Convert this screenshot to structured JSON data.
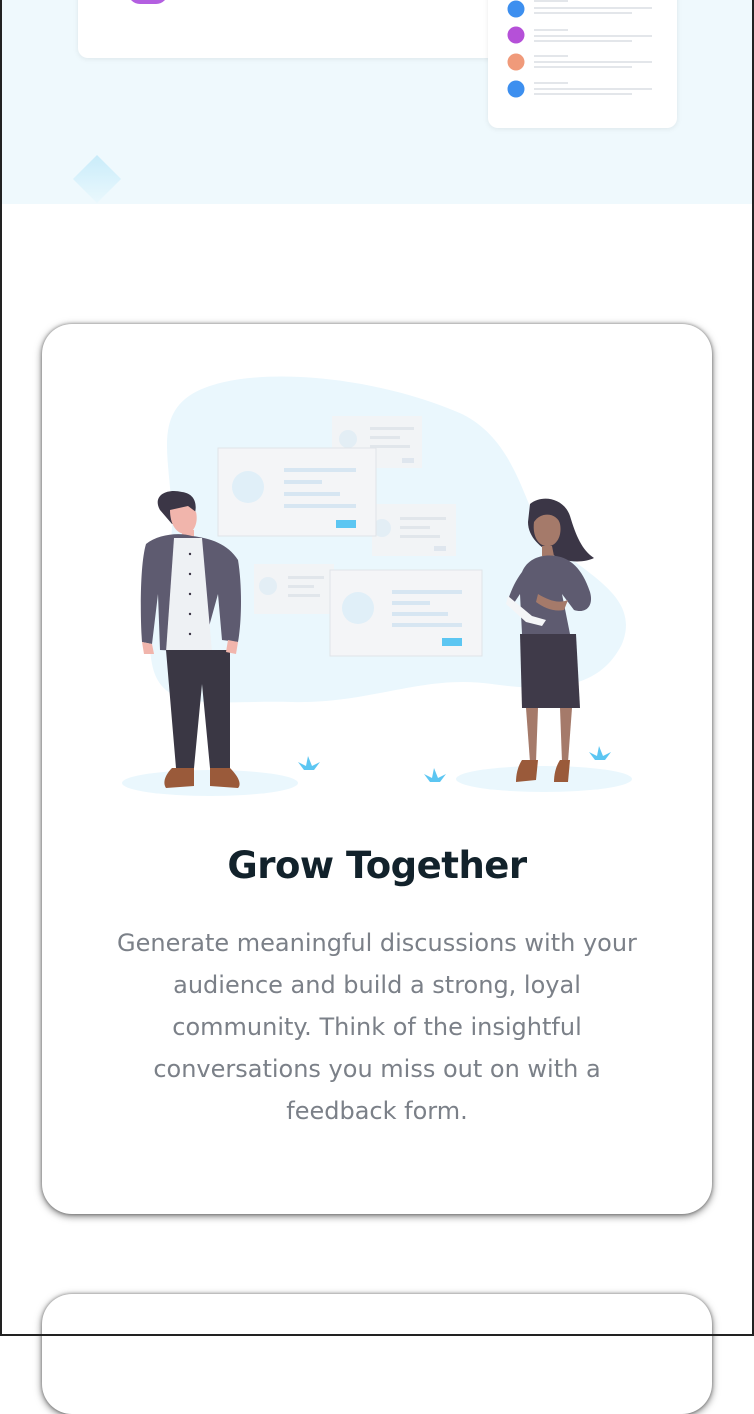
{
  "feature_card": {
    "title": "Grow Together",
    "description": "Generate meaningful discussions with your audience and build a strong, loyal community. Think of the insightful conversations you miss out on with a feedback form.",
    "illustration": "two-people-discussion-illustration"
  },
  "colors": {
    "hero_background": "#eff9fd",
    "title": "#12222b",
    "body_text": "#7b8088",
    "accent_blue": "#3d8fef",
    "accent_purple": "#b35fe0",
    "accent_coral": "#f09a7a"
  }
}
